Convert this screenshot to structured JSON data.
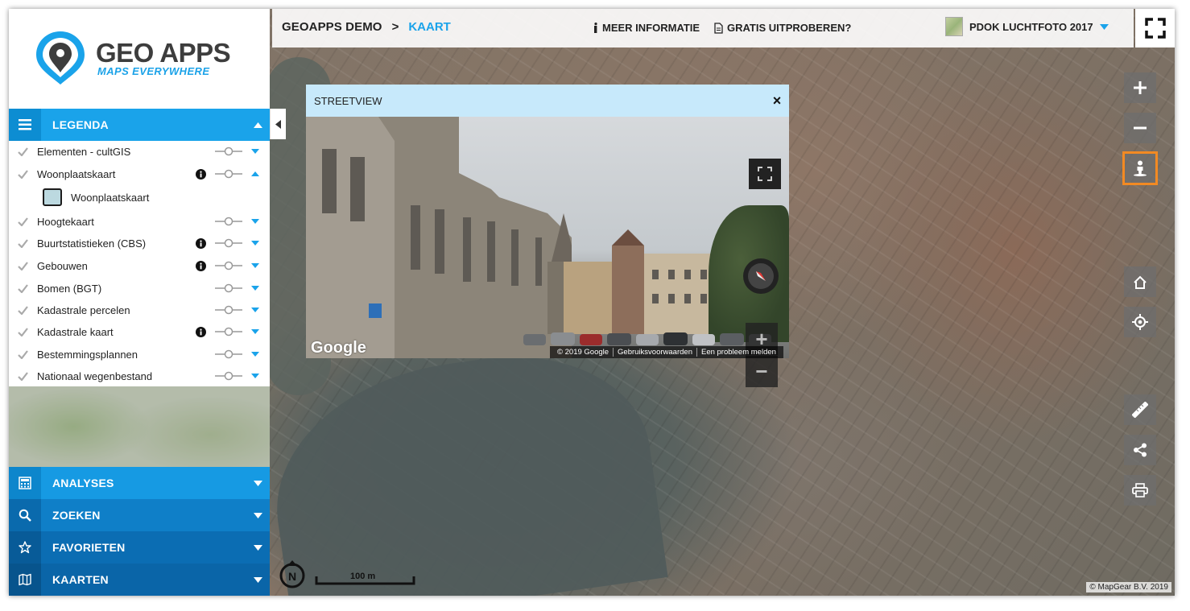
{
  "logo": {
    "title": "GEO APPS",
    "subtitle": "MAPS EVERYWHERE"
  },
  "breadcrumb": {
    "root": "GEOAPPS DEMO",
    "separator": ">",
    "current": "KAART"
  },
  "topbar": {
    "info_link": "MEER INFORMATIE",
    "trial_link": "GRATIS UITPROBEREN?",
    "basemap": "PDOK LUCHTFOTO 2017"
  },
  "legend": {
    "title": "LEGENDA",
    "items": [
      {
        "label": "Elementen - cultGIS",
        "info": false,
        "expanded": false
      },
      {
        "label": "Woonplaatskaart",
        "info": true,
        "expanded": true
      },
      {
        "label": "Hoogtekaart",
        "info": false,
        "expanded": false
      },
      {
        "label": "Buurtstatistieken (CBS)",
        "info": true,
        "expanded": false
      },
      {
        "label": "Gebouwen",
        "info": true,
        "expanded": false
      },
      {
        "label": "Bomen (BGT)",
        "info": false,
        "expanded": false
      },
      {
        "label": "Kadastrale percelen",
        "info": false,
        "expanded": false
      },
      {
        "label": "Kadastrale kaart",
        "info": true,
        "expanded": false
      },
      {
        "label": "Bestemmingsplannen",
        "info": false,
        "expanded": false
      },
      {
        "label": "Nationaal wegenbestand",
        "info": false,
        "expanded": false
      }
    ],
    "sub_item": {
      "label": "Woonplaatskaart",
      "swatch_color": "#bcd9e0"
    }
  },
  "panels": {
    "analyses": "ANALYSES",
    "zoeken": "ZOEKEN",
    "favorieten": "FAVORIETEN",
    "kaarten": "KAARTEN"
  },
  "streetview": {
    "title": "STREETVIEW",
    "close": "×",
    "google": "Google",
    "copyright": "© 2019 Google",
    "terms": "Gebruiksvoorwaarden",
    "report": "Een probleem melden",
    "zoom_in": "+",
    "zoom_out": "−"
  },
  "map": {
    "scale": "100 m",
    "north": "N",
    "attribution": "© MapGear B.V. 2019"
  },
  "colors": {
    "accent": "#1aa3ea",
    "active_tool_border": "#f28a23"
  }
}
